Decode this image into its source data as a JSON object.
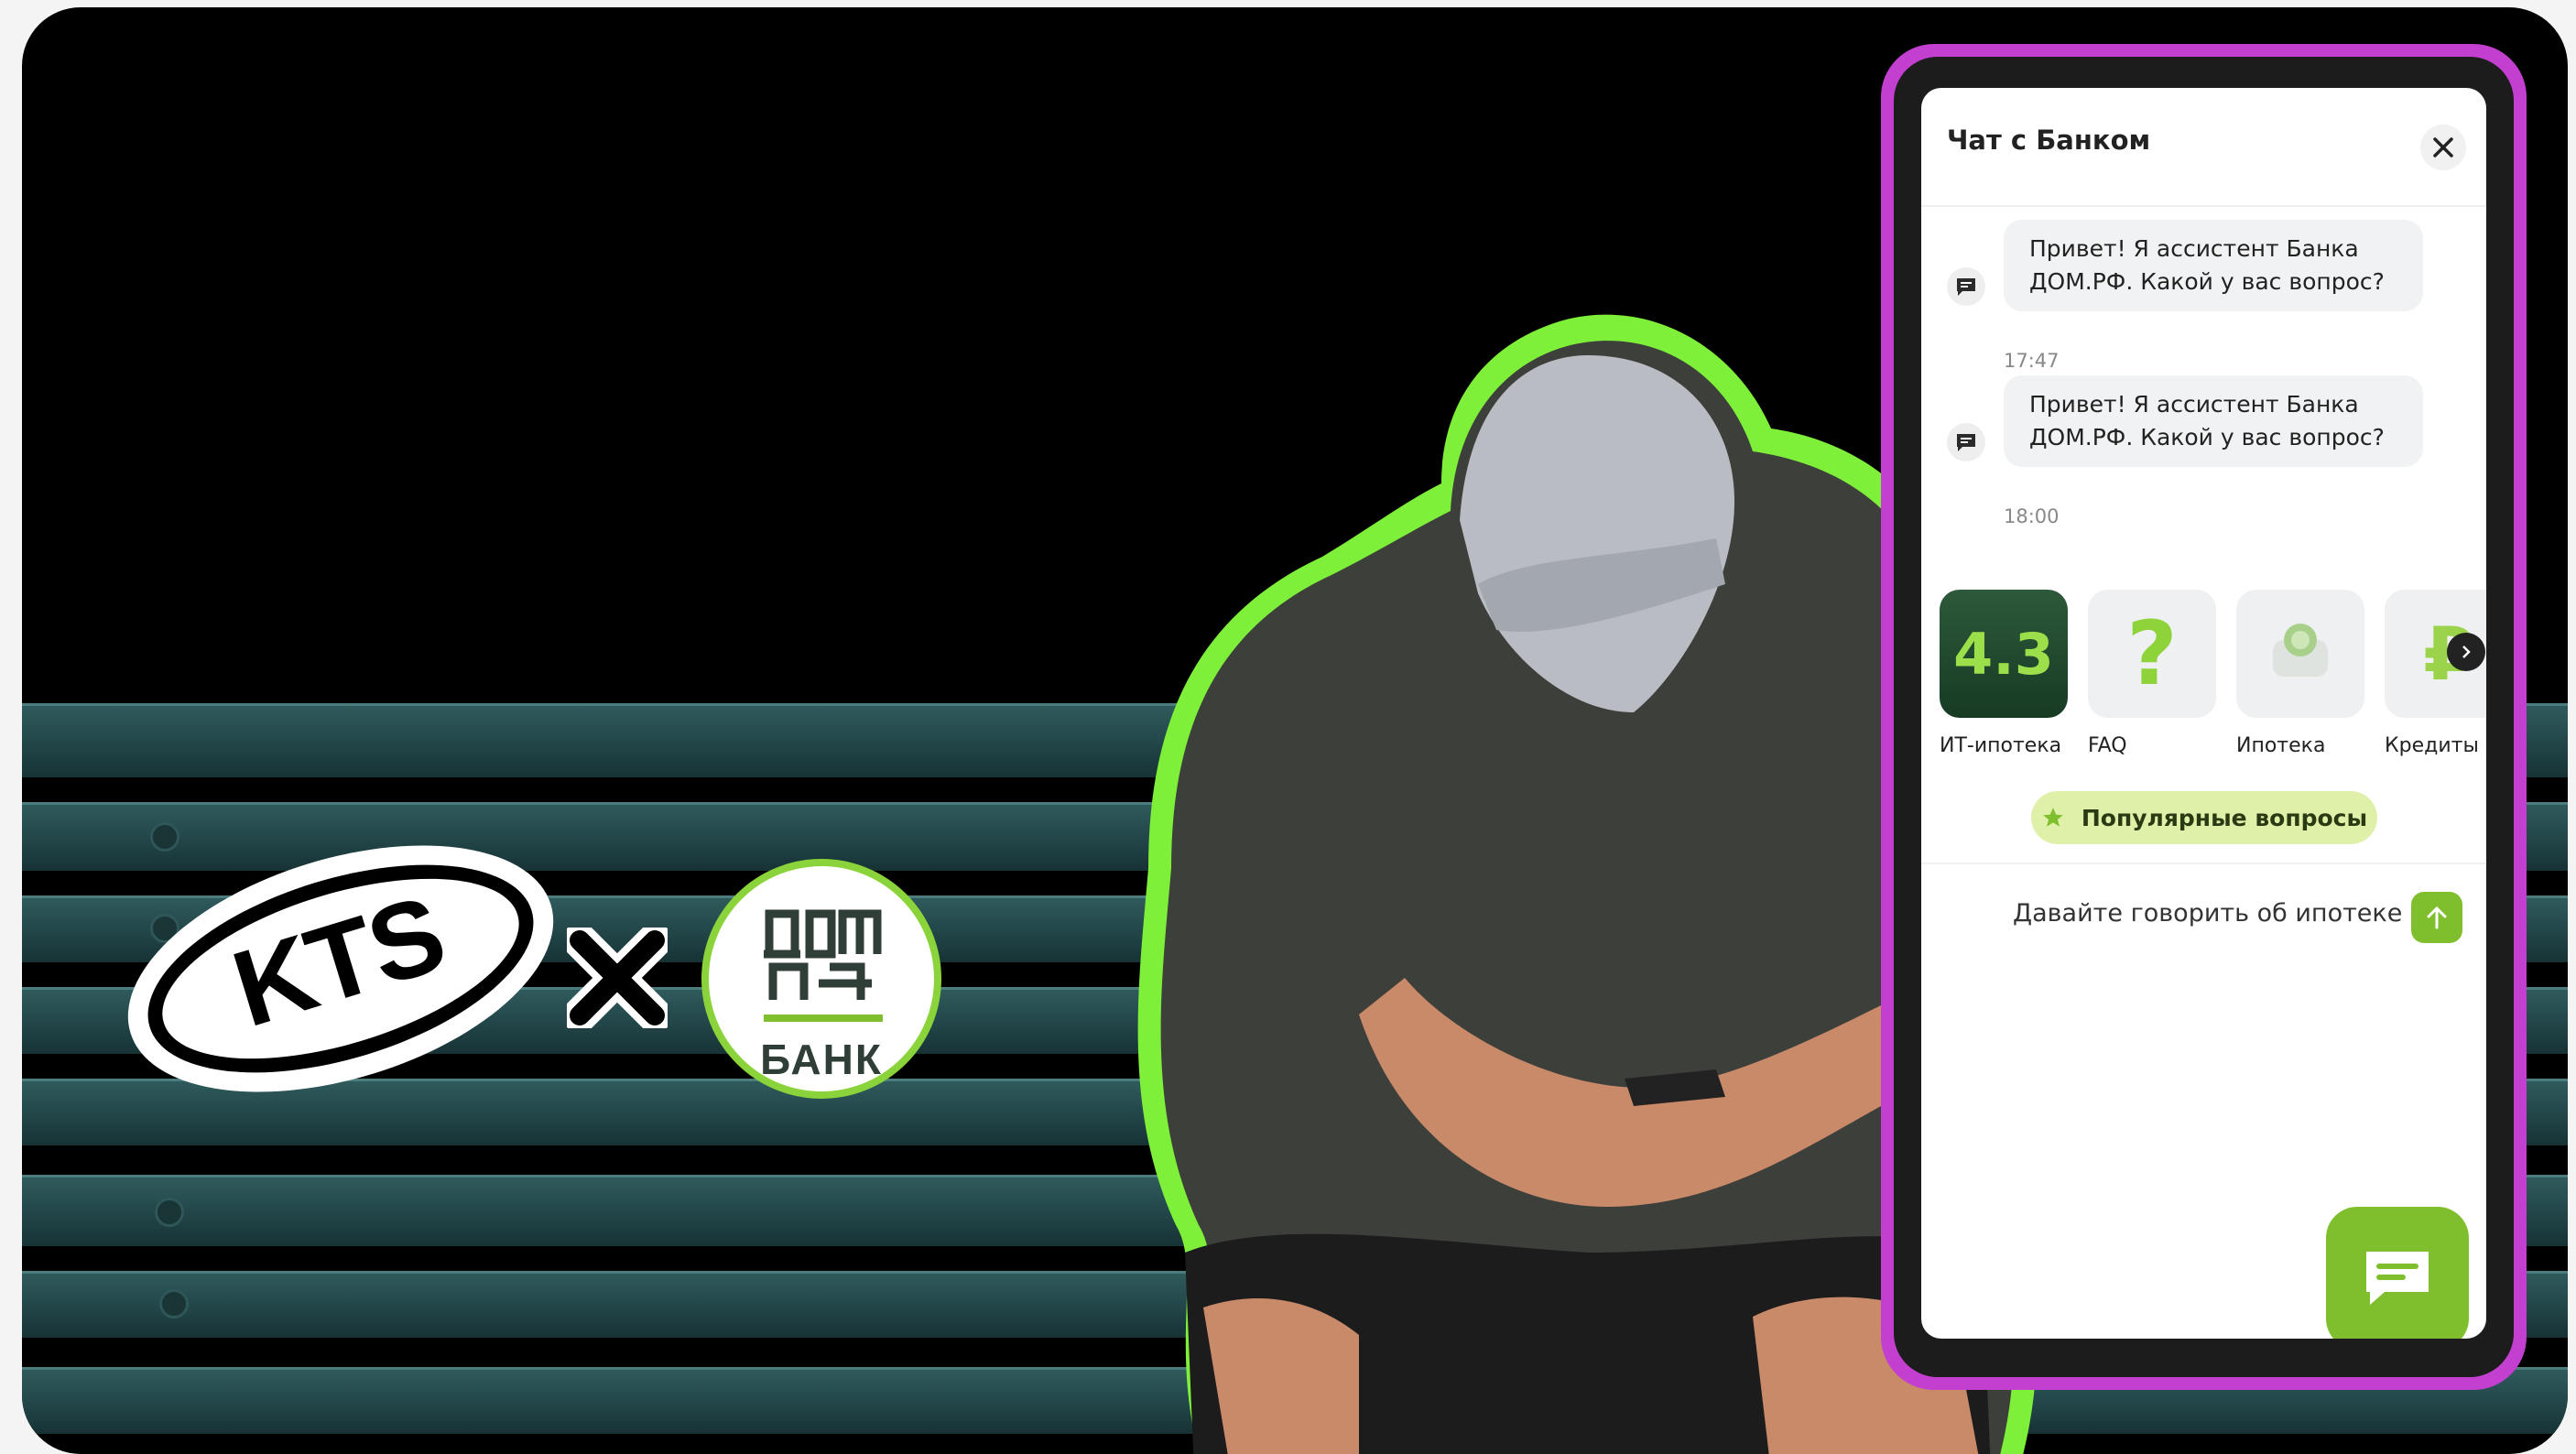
{
  "chat": {
    "title": "Чат с Банком",
    "messages": [
      {
        "text": "Привет! Я ассистент Банка ДОМ.РФ. Какой у вас вопрос?",
        "time": "17:47"
      },
      {
        "text": "Привет! Я ассистент Банка ДОМ.РФ. Какой у вас вопрос?",
        "time": "18:00"
      }
    ],
    "categories": [
      {
        "label": "ИТ-ипотека",
        "tile_text": "4.3"
      },
      {
        "label": "FAQ",
        "tile_text": "?"
      },
      {
        "label": "Ипотека",
        "tile_text": ""
      },
      {
        "label": "Кредиты",
        "tile_text": "₽"
      }
    ],
    "popular_button": "Популярные вопросы",
    "input_value": "Давайте говорить об ипотеке"
  },
  "logos": {
    "kts": "KTS",
    "dom_bank": "БАНК"
  },
  "colors": {
    "accent_green": "#7fbf2e",
    "phone_frame": "#c23fd0",
    "outline_green": "#7ff03a"
  }
}
